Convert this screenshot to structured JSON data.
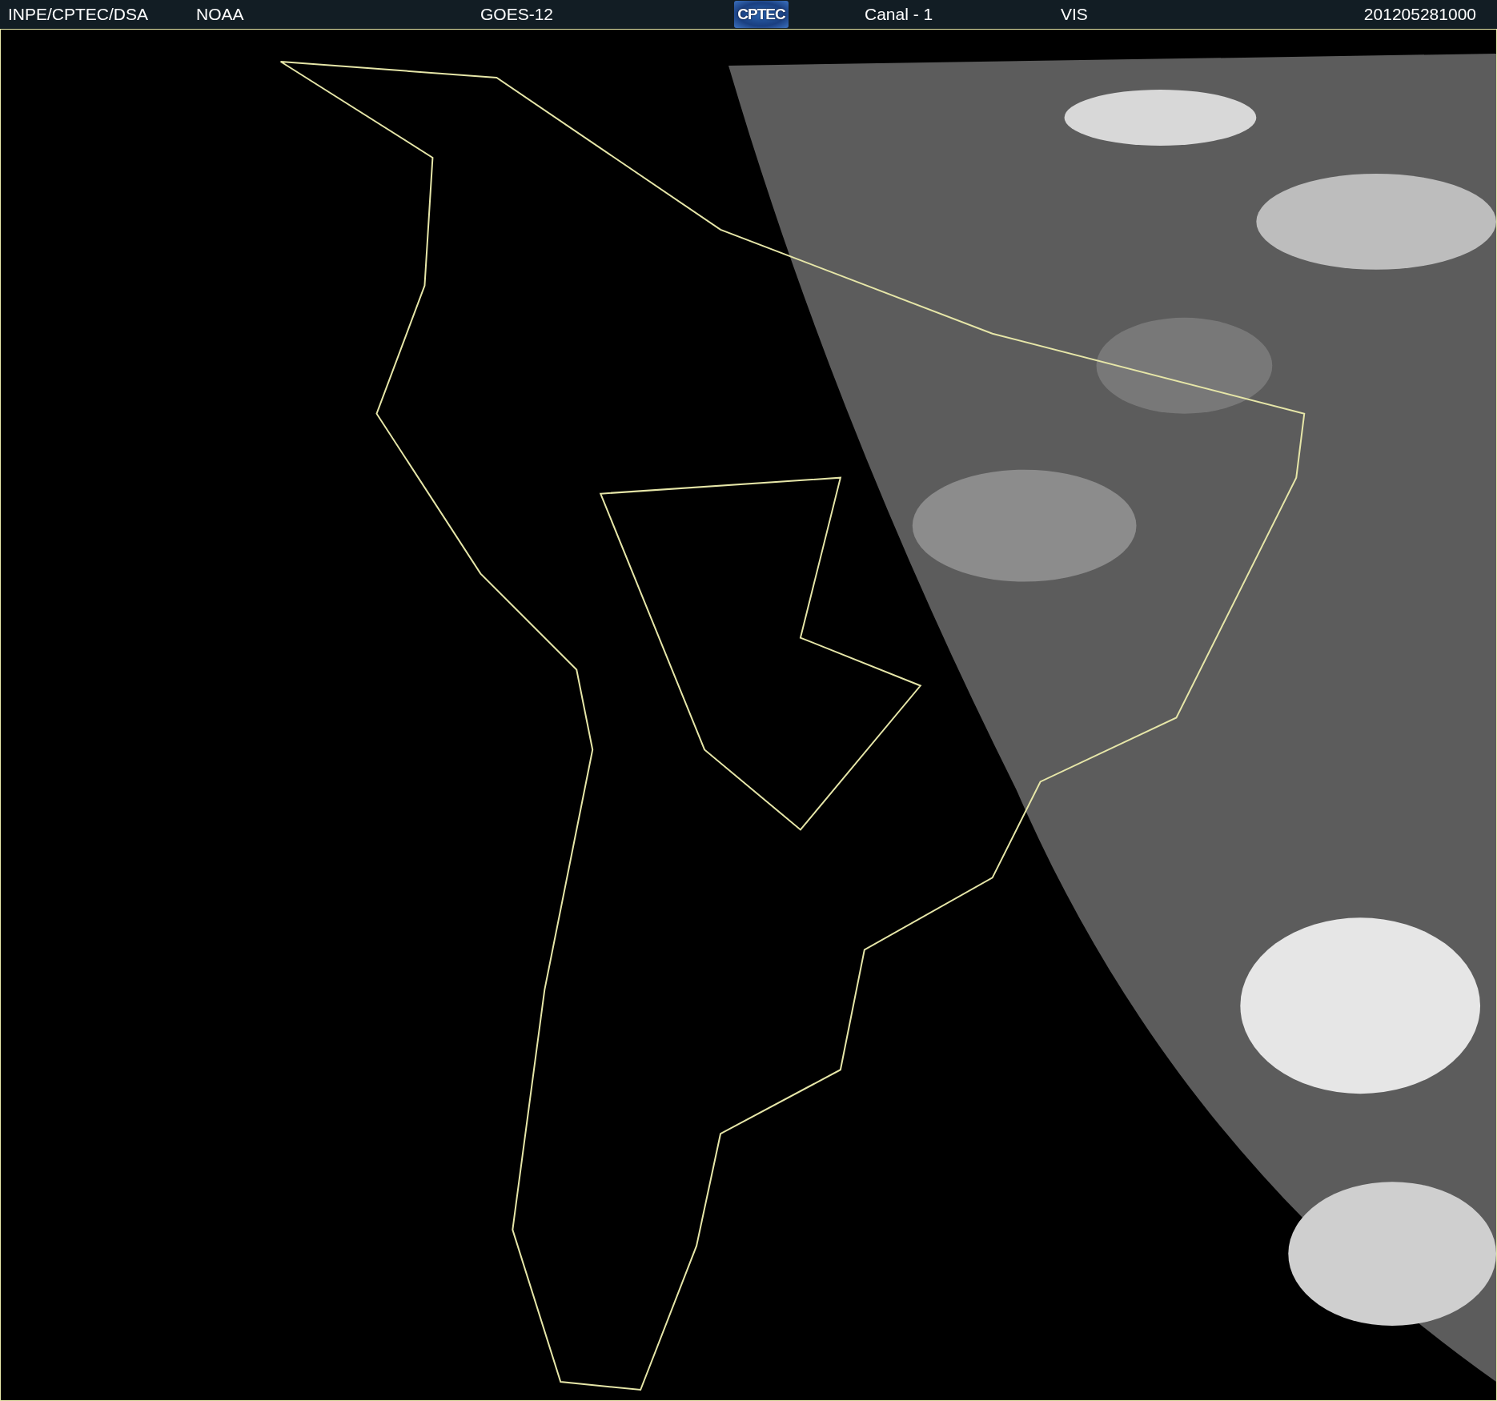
{
  "header": {
    "items": [
      {
        "kind": "text",
        "text": "INPE/CPTEC/DSA"
      },
      {
        "kind": "text",
        "text": "NOAA"
      },
      {
        "kind": "text",
        "text": "GOES-12"
      },
      {
        "kind": "logo",
        "text": "CPTEC"
      },
      {
        "kind": "text",
        "text": "Canal - 1"
      },
      {
        "kind": "text",
        "text": "VIS"
      },
      {
        "kind": "text",
        "text": "201205281000"
      }
    ]
  }
}
